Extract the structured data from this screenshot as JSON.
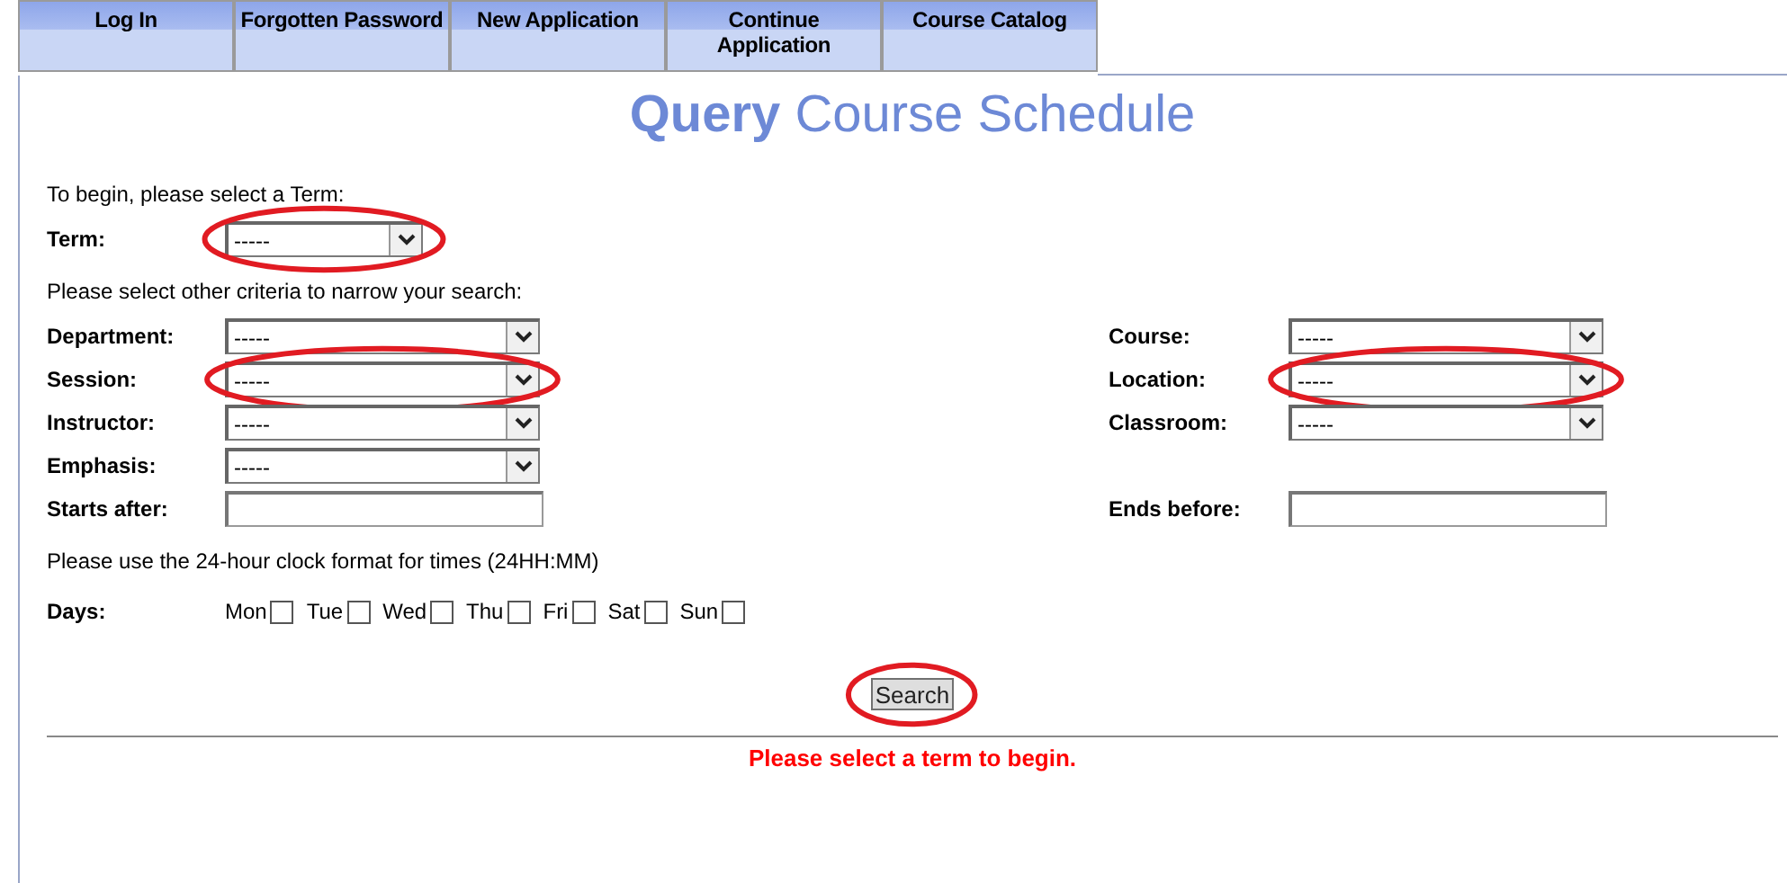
{
  "nav_tabs": [
    {
      "label": "Log In"
    },
    {
      "label": "Forgotten Password"
    },
    {
      "label": "New Application"
    },
    {
      "label": "Continue Application"
    },
    {
      "label": "Course Catalog"
    }
  ],
  "title": {
    "bold": "Query",
    "rest": "Course Schedule"
  },
  "intro": "To begin, please select a Term:",
  "term": {
    "label": "Term:",
    "value": "-----",
    "highlighted": true
  },
  "criteria_text": "Please select other criteria to narrow your search:",
  "filter_rows": [
    {
      "left": {
        "label": "Department:",
        "kind": "select",
        "value": "-----",
        "highlighted": false
      },
      "right": {
        "label": "Course:",
        "kind": "select",
        "value": "-----",
        "highlighted": false
      }
    },
    {
      "left": {
        "label": "Session:",
        "kind": "select",
        "value": "-----",
        "highlighted": true
      },
      "right": {
        "label": "Location:",
        "kind": "select",
        "value": "-----",
        "highlighted": true
      }
    },
    {
      "left": {
        "label": "Instructor:",
        "kind": "select",
        "value": "-----",
        "highlighted": false
      },
      "right": {
        "label": "Classroom:",
        "kind": "select",
        "value": "-----",
        "highlighted": false
      }
    },
    {
      "left": {
        "label": "Emphasis:",
        "kind": "select",
        "value": "-----",
        "highlighted": false
      }
    },
    {
      "left": {
        "label": "Starts after:",
        "kind": "text"
      },
      "right": {
        "label": "Ends before:",
        "kind": "text"
      }
    }
  ],
  "time_hint": "Please use the 24-hour clock format for times (24HH:MM)",
  "days": {
    "label": "Days:",
    "items": [
      {
        "label": "Mon",
        "checked": false
      },
      {
        "label": "Tue",
        "checked": false
      },
      {
        "label": "Wed",
        "checked": false
      },
      {
        "label": "Thu",
        "checked": false
      },
      {
        "label": "Fri",
        "checked": false
      },
      {
        "label": "Sat",
        "checked": false
      },
      {
        "label": "Sun",
        "checked": false
      }
    ]
  },
  "search_button": {
    "label": "Search",
    "highlighted": true
  },
  "message": "Please select a term to begin."
}
